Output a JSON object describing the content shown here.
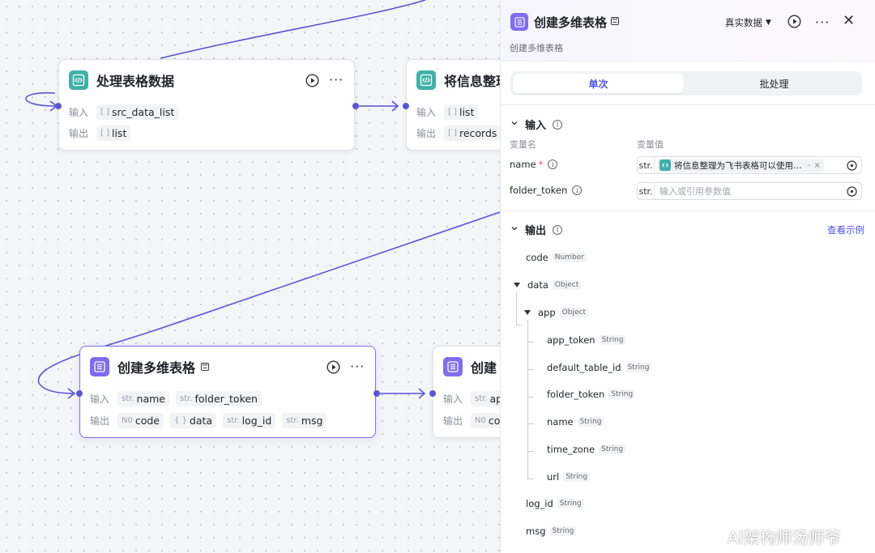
{
  "canvas": {
    "node1": {
      "title": "处理表格数据",
      "input_label": "输入",
      "output_label": "输出",
      "inputs": [
        {
          "type": "[ ]",
          "name": "src_data_list"
        }
      ],
      "outputs": [
        {
          "type": "[ ]",
          "name": "list"
        }
      ]
    },
    "node2": {
      "title": "将信息整理",
      "input_label": "输入",
      "output_label": "输出",
      "inputs": [
        {
          "type": "[ ]",
          "name": "list"
        }
      ],
      "outputs": [
        {
          "type": "[ ]",
          "name": "records"
        }
      ]
    },
    "node3": {
      "title": "创建多维表格",
      "input_label": "输入",
      "output_label": "输出",
      "inputs": [
        {
          "type": "str.",
          "name": "name"
        },
        {
          "type": "str.",
          "name": "folder_token"
        }
      ],
      "outputs": [
        {
          "type": "N0",
          "name": "code"
        },
        {
          "type": "{ }",
          "name": "data"
        },
        {
          "type": "str.",
          "name": "log_id"
        },
        {
          "type": "str.",
          "name": "msg"
        }
      ]
    },
    "node4": {
      "title": "创建",
      "input_label": "输入",
      "output_label": "输出",
      "inputs": [
        {
          "type": "str.",
          "name": "app"
        }
      ],
      "outputs": [
        {
          "type": "N0",
          "name": "co"
        }
      ]
    }
  },
  "panel": {
    "title": "创建多维表格",
    "subtitle": "创建多维表格",
    "mode": "真实数据",
    "tabs": [
      "单次",
      "批处理"
    ],
    "input_section": {
      "title": "输入",
      "col_name": "变量名",
      "col_value": "变量值",
      "vars": [
        {
          "name": "name",
          "required": "*",
          "type": "str.",
          "value": "将信息整理为飞书表格可以使用的...",
          "placeholder": ""
        },
        {
          "name": "folder_token",
          "required": "",
          "type": "str.",
          "value": "",
          "placeholder": "输入或引用参数值"
        }
      ]
    },
    "output_section": {
      "title": "输出",
      "link": "查看示例",
      "fields": [
        {
          "name": "code",
          "type": "Number"
        },
        {
          "name": "data",
          "type": "Object"
        },
        {
          "name": "app",
          "type": "Object"
        },
        {
          "name": "app_token",
          "type": "String"
        },
        {
          "name": "default_table_id",
          "type": "String"
        },
        {
          "name": "folder_token",
          "type": "String"
        },
        {
          "name": "name",
          "type": "String"
        },
        {
          "name": "time_zone",
          "type": "String"
        },
        {
          "name": "url",
          "type": "String"
        },
        {
          "name": "log_id",
          "type": "String"
        },
        {
          "name": "msg",
          "type": "String"
        }
      ]
    }
  },
  "watermark": "AI架构师汤师爷",
  "colors": {
    "accent": "#4d53e8",
    "edge": "#5a55d6",
    "code_icon": "#3fb1a8",
    "table_icon": "#7f6cf2"
  },
  "icons": [
    "code-icon",
    "table-icon",
    "save-icon",
    "play-icon",
    "more-icon",
    "close-icon",
    "info-icon",
    "reference-icon",
    "chevron-down-icon"
  ]
}
